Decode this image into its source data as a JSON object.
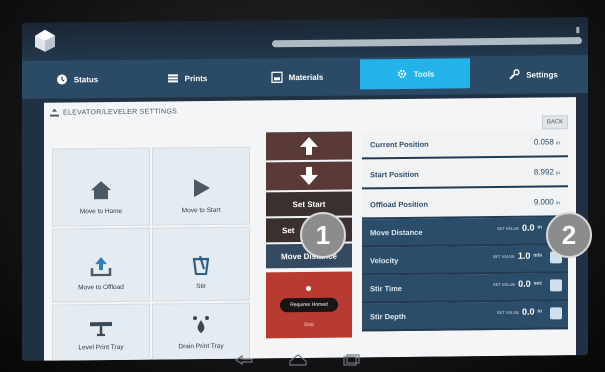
{
  "tabs": [
    {
      "label": "Status",
      "icon": "clock-icon"
    },
    {
      "label": "Prints",
      "icon": "list-icon"
    },
    {
      "label": "Materials",
      "icon": "materials-icon"
    },
    {
      "label": "Tools",
      "icon": "gear-icon"
    },
    {
      "label": "Settings",
      "icon": "wrench-icon"
    }
  ],
  "panel": {
    "title": "ELEVATOR/LEVELER SETTINGS",
    "back_label": "BACK"
  },
  "tiles": [
    {
      "label": "Move to Home",
      "icon": "home-icon"
    },
    {
      "label": "Move to Start",
      "icon": "play-icon"
    },
    {
      "label": "Move to Offload",
      "icon": "upload-icon"
    },
    {
      "label": "Stir",
      "icon": "stir-icon"
    },
    {
      "label": "Level Print Tray",
      "icon": "level-icon"
    },
    {
      "label": "Drain Print Tray",
      "icon": "drain-icon"
    }
  ],
  "middle": {
    "set_start": "Set Start",
    "set_offload": "Set",
    "move_distance": "Move Distance",
    "stop_label": "Requires Homed",
    "stop_sub": "Stop"
  },
  "rows": [
    {
      "label": "Current Position",
      "value": "0.058",
      "unit": "in"
    },
    {
      "label": "Start Position",
      "value": "8.992",
      "unit": "in"
    },
    {
      "label": "Offload Position",
      "value": "9.000",
      "unit": "in"
    },
    {
      "label": "Move Distance",
      "value": "0.0",
      "unit": "in",
      "tag": "SET VALUE"
    },
    {
      "label": "Velocity",
      "value": "1.0",
      "unit": "in/s",
      "tag": "SET VALUE"
    },
    {
      "label": "Stir Time",
      "value": "0.0",
      "unit": "sec",
      "tag": "SET VALUE"
    },
    {
      "label": "Stir Depth",
      "value": "0.0",
      "unit": "in",
      "tag": "SET VALUE"
    }
  ],
  "markers": [
    "1",
    "2"
  ],
  "colors": {
    "active_tab": "#24b3e8",
    "stop": "#b83b32",
    "row": "#2c4d6a"
  }
}
